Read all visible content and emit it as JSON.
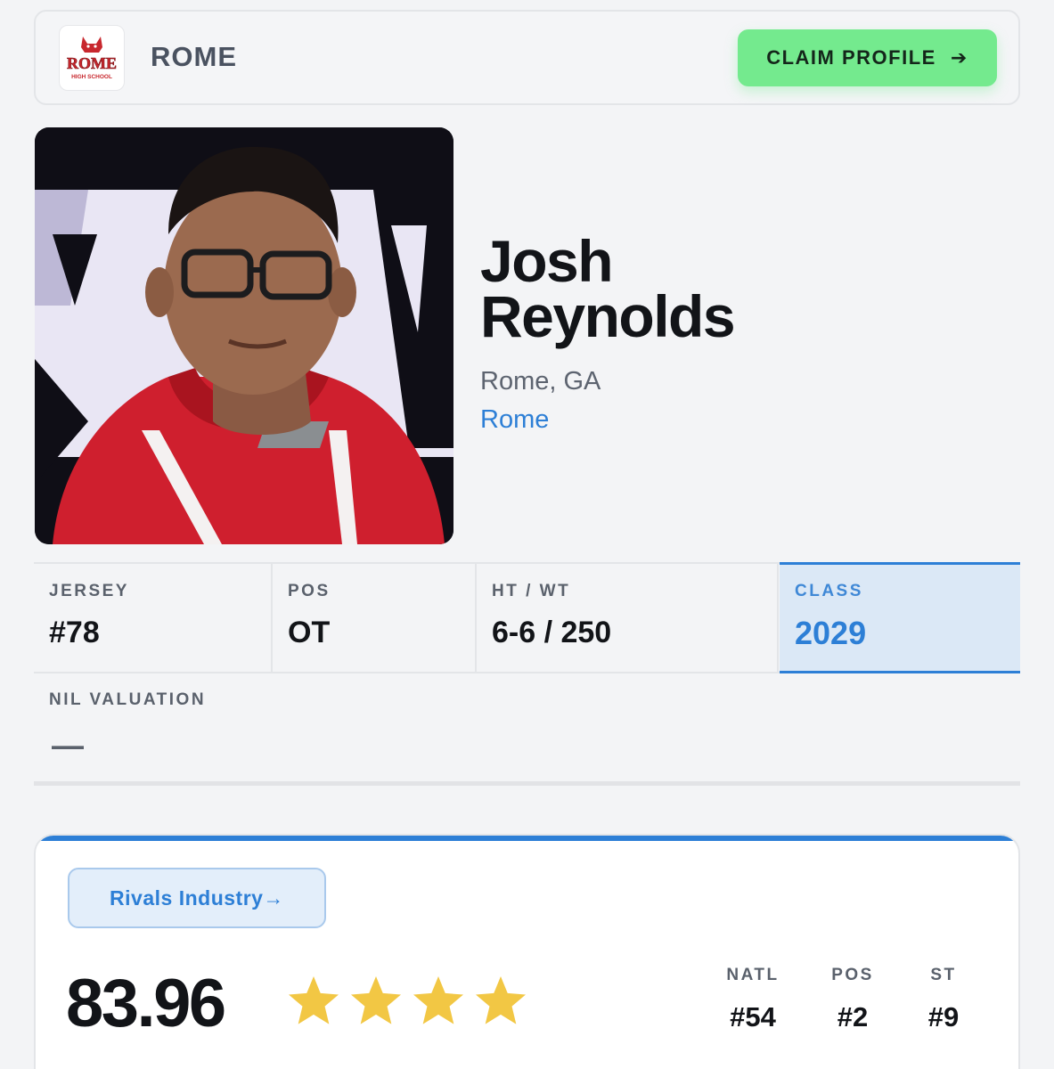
{
  "header": {
    "logo_text": "ROME",
    "logo_subtext": "HIGH SCHOOL",
    "team_name": "ROME",
    "claim_label": "CLAIM PROFILE",
    "claim_icon": "arrow-right-icon"
  },
  "player": {
    "first_name": "Josh",
    "last_name": "Reynolds",
    "hometown": "Rome, GA",
    "school": "Rome"
  },
  "stats": {
    "jersey": {
      "label": "JERSEY",
      "value": "#78"
    },
    "pos": {
      "label": "POS",
      "value": "OT"
    },
    "htwt": {
      "label": "HT / WT",
      "value": "6-6 / 250"
    },
    "class": {
      "label": "CLASS",
      "value": "2029"
    }
  },
  "nil": {
    "label": "NIL VALUATION",
    "value": "—"
  },
  "rating_card": {
    "source_label": "Rivals Industry→",
    "rating": "83.96",
    "stars": 4,
    "ranks": [
      {
        "label": "NATL",
        "value": "#54"
      },
      {
        "label": "POS",
        "value": "#2"
      },
      {
        "label": "ST",
        "value": "#9"
      }
    ]
  },
  "colors": {
    "accent_blue": "#2d7fd6",
    "claim_green": "#74ea8e",
    "star_gold": "#f2c744"
  }
}
